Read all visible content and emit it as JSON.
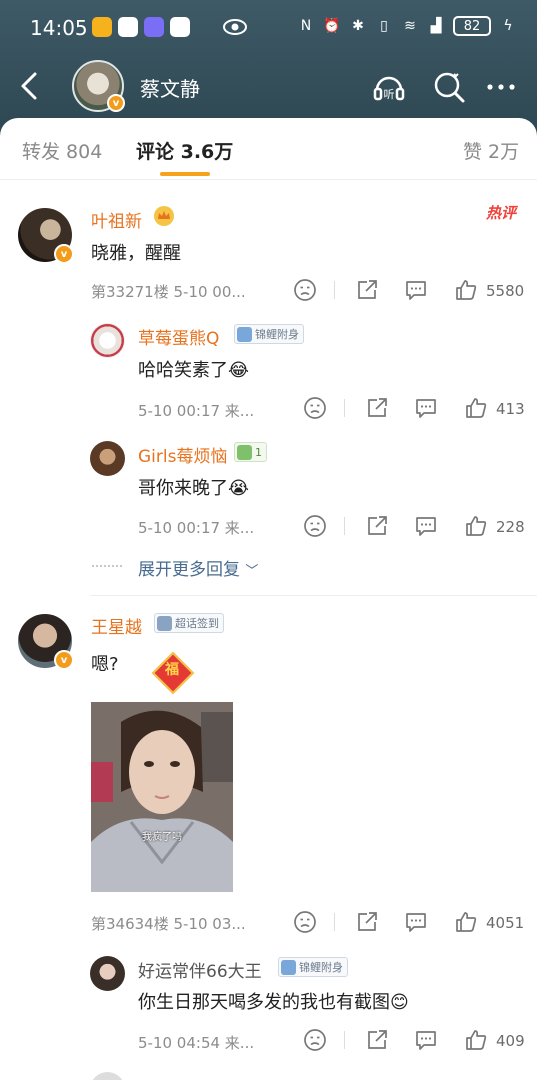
{
  "status_bar": {
    "time": "14:05",
    "battery": "82"
  },
  "header": {
    "title": "蔡文静",
    "verified_mark": "v"
  },
  "tabs": {
    "repost": "转发 804",
    "comments": "评论 3.6万",
    "likes": "赞 2万"
  },
  "comments": [
    {
      "user": "叶祖新",
      "text": "晓雅，醒醒",
      "hot_label": "热评",
      "meta": "第33271楼 5-10 00...",
      "likes": "5580",
      "replies": [
        {
          "user": "草莓蛋熊Q",
          "badge": "锦鲤附身",
          "text": "哈哈笑素了😂",
          "meta": "5-10 00:17 来...",
          "likes": "413"
        },
        {
          "user": "Girls莓烦恼",
          "badge": "1",
          "text": "哥你来晚了😭",
          "meta": "5-10 00:17 来...",
          "likes": "228"
        }
      ],
      "expand": "展开更多回复"
    },
    {
      "user": "王星越",
      "badge": "超话签到",
      "text": "嗯?",
      "image_caption": "我疯了吗",
      "sticker_text": "福",
      "meta": "第34634楼 5-10 03...",
      "likes": "4051",
      "replies": [
        {
          "user": "好运常伴66大王",
          "badge": "锦鲤附身",
          "text": "你生日那天喝多发的我也有截图😊",
          "meta": "5-10 04:54 来...",
          "likes": "409"
        }
      ]
    }
  ],
  "colors": {
    "username": "#e8731f",
    "accent": "#f7a21b",
    "hot": "#f0423b",
    "link": "#486b8f"
  },
  "icons": [
    "back-icon",
    "listen-icon",
    "search-icon",
    "more-icon",
    "dislike-icon",
    "share-icon",
    "comment-icon",
    "like-icon"
  ]
}
